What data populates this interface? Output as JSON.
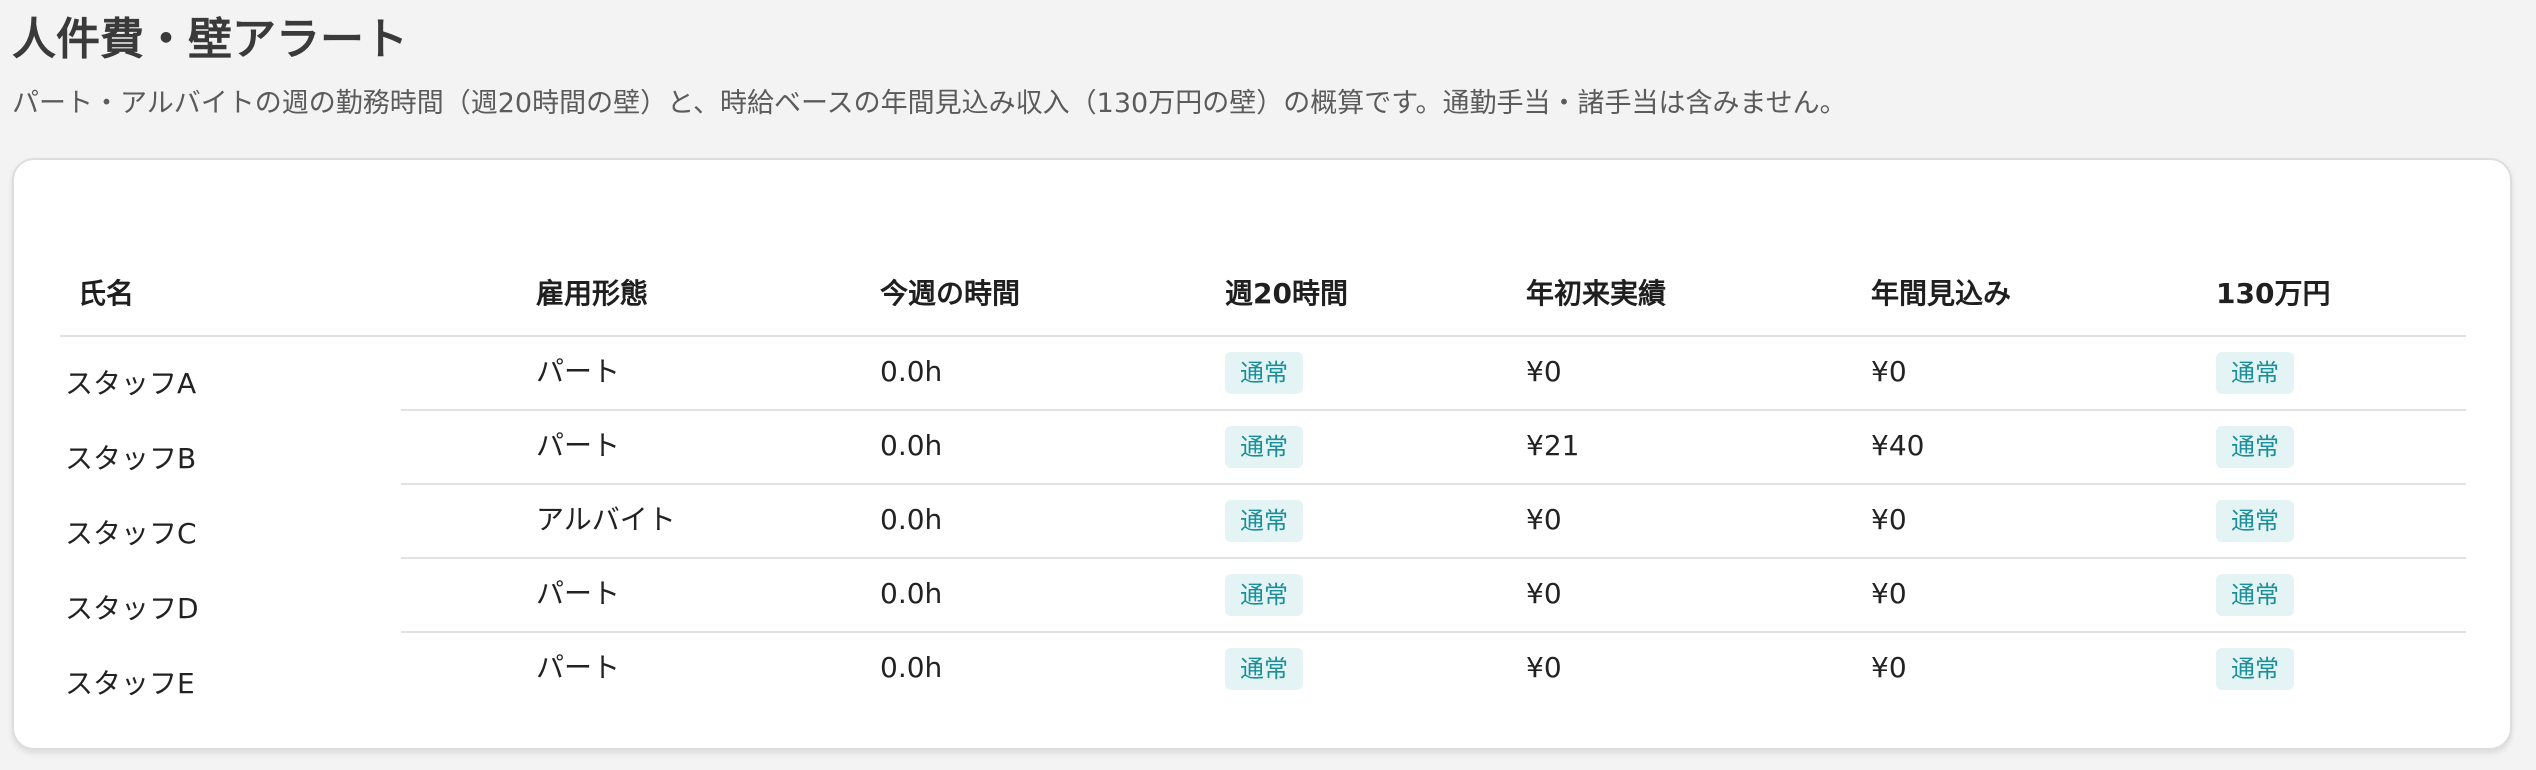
{
  "page": {
    "title": "人件費・壁アラート",
    "description": "パート・アルバイトの週の勤務時間（週20時間の壁）と、時給ベースの年間見込み収入（130万円の壁）の概算です。通勤手当・諸手当は含みません。"
  },
  "table": {
    "headers": {
      "name": "氏名",
      "employment": "雇用形態",
      "this_week_hours": "今週の時間",
      "week20": "週20時間",
      "ytd": "年初来実績",
      "annual_forecast": "年間見込み",
      "wall130": "130万円"
    },
    "rows": [
      {
        "name": "スタッフA",
        "employment": "パート",
        "hours": "0.0h",
        "week20": "通常",
        "ytd": "¥0",
        "forecast": "¥0",
        "wall130": "通常"
      },
      {
        "name": "スタッフB",
        "employment": "パート",
        "hours": "0.0h",
        "week20": "通常",
        "ytd": "¥21",
        "forecast": "¥40",
        "wall130": "通常"
      },
      {
        "name": "スタッフC",
        "employment": "アルバイト",
        "hours": "0.0h",
        "week20": "通常",
        "ytd": "¥0",
        "forecast": "¥0",
        "wall130": "通常"
      },
      {
        "name": "スタッフD",
        "employment": "パート",
        "hours": "0.0h",
        "week20": "通常",
        "ytd": "¥0",
        "forecast": "¥0",
        "wall130": "通常"
      },
      {
        "name": "スタッフE",
        "employment": "パート",
        "hours": "0.0h",
        "week20": "通常",
        "ytd": "¥0",
        "forecast": "¥0",
        "wall130": "通常"
      }
    ]
  },
  "colors": {
    "badge_bg": "#e4f4f5",
    "badge_text": "#1b8f99"
  }
}
